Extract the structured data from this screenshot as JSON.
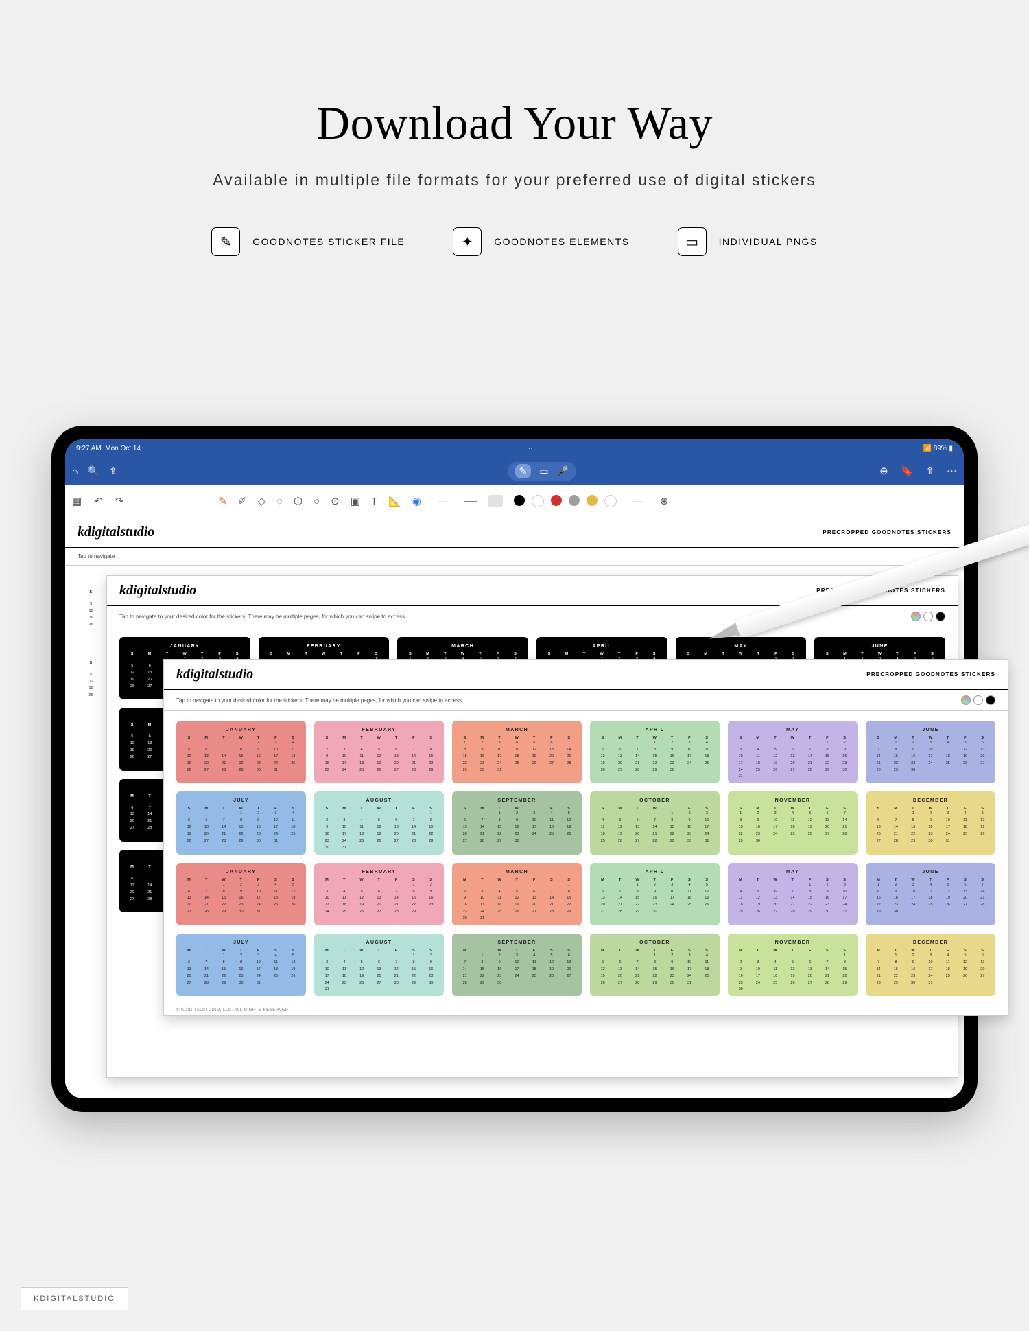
{
  "heading": "Download Your Way",
  "subheading": "Available in multiple file formats for your preferred use of digital stickers",
  "formats": [
    {
      "icon": "pen-icon",
      "glyph": "✎",
      "label": "GOODNOTES STICKER FILE"
    },
    {
      "icon": "star-icon",
      "glyph": "✦",
      "label": "GOODNOTES ELEMENTS"
    },
    {
      "icon": "folder-icon",
      "glyph": "▭",
      "label": "INDIVIDUAL PNGS"
    }
  ],
  "ipad": {
    "time": "9:27 AM",
    "date": "Mon Oct 14",
    "battery": "89%",
    "toolbar_colors": [
      "#000000",
      "#ffffff",
      "#d32f2f",
      "#9e9e9e",
      "#e6b84c",
      "#ffffff"
    ]
  },
  "sheet": {
    "brand": "kdigitalstudio",
    "tag": "PRECROPPED GOODNOTES STICKERS",
    "note": "Tap to navigate to your desired color for the stickers. There may be multiple pages, for which you can swipe to access.",
    "short_note": "Tap to navigate",
    "copyright": "© KDIGITALSTUDIO, LLC. ALL RIGHTS RESERVED."
  },
  "swatch_colors": [
    "conic-gradient(#e88,#8ce,#9d8,#e88)",
    "#ffffff",
    "#000000"
  ],
  "dow_sun": [
    "S",
    "M",
    "T",
    "W",
    "T",
    "F",
    "S"
  ],
  "dow_mon": [
    "M",
    "T",
    "W",
    "T",
    "F",
    "S",
    "S"
  ],
  "months": [
    {
      "name": "JANUARY",
      "color": "#e98c88",
      "start": 3,
      "len": 31
    },
    {
      "name": "FEBRUARY",
      "color": "#f0a7b8",
      "start": 6,
      "len": 29
    },
    {
      "name": "MARCH",
      "color": "#f1a087",
      "start": 0,
      "len": 31
    },
    {
      "name": "APRIL",
      "color": "#b3dcb5",
      "start": 3,
      "len": 30
    },
    {
      "name": "MAY",
      "color": "#c3b4e6",
      "start": 5,
      "len": 31
    },
    {
      "name": "JUNE",
      "color": "#aab2e2",
      "start": 1,
      "len": 30
    },
    {
      "name": "JULY",
      "color": "#93bbe6",
      "start": 3,
      "len": 31
    },
    {
      "name": "AUGUST",
      "color": "#b5e0d6",
      "start": 6,
      "len": 31
    },
    {
      "name": "SEPTEMBER",
      "color": "#a5c3a0",
      "start": 2,
      "len": 30
    },
    {
      "name": "OCTOBER",
      "color": "#bdd89e",
      "start": 4,
      "len": 31
    },
    {
      "name": "NOVEMBER",
      "color": "#c8e29c",
      "start": 0,
      "len": 30
    },
    {
      "name": "DECEMBER",
      "color": "#e8d98a",
      "start": 2,
      "len": 31
    }
  ],
  "footer": "KDIGITALSTUDIO"
}
